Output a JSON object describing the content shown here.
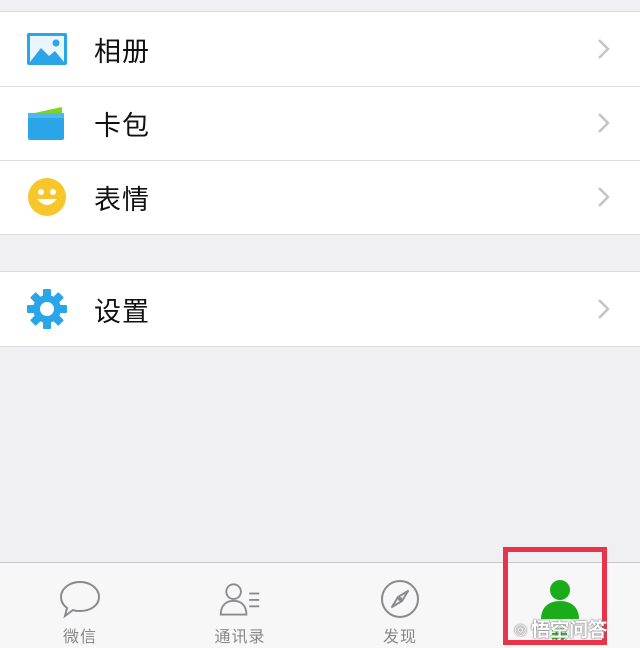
{
  "menu_group_1": [
    {
      "label": "相册",
      "icon": "photo-album-icon"
    },
    {
      "label": "卡包",
      "icon": "card-wallet-icon"
    },
    {
      "label": "表情",
      "icon": "smiley-face-icon"
    }
  ],
  "menu_group_2": [
    {
      "label": "设置",
      "icon": "gear-icon"
    }
  ],
  "tabbar": {
    "tabs": [
      {
        "label": "微信",
        "icon": "chat-bubble-icon",
        "active": false
      },
      {
        "label": "通讯录",
        "icon": "contacts-icon",
        "active": false
      },
      {
        "label": "发现",
        "icon": "compass-icon",
        "active": false
      },
      {
        "label": "我",
        "icon": "person-icon",
        "active": true
      }
    ]
  },
  "watermark": {
    "text": "悟空问答"
  },
  "colors": {
    "accent_green": "#1aad19",
    "highlight_red": "#e8334a",
    "icon_blue": "#29a5e8",
    "smiley_yellow": "#f7c62b"
  }
}
